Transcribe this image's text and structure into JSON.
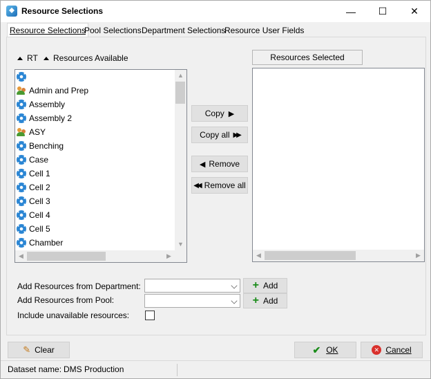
{
  "window": {
    "title": "Resource Selections",
    "minimize_glyph": "—",
    "maximize_glyph": "☐",
    "close_glyph": "✕"
  },
  "tabs": [
    {
      "label": "Resource Selections",
      "active": true
    },
    {
      "label": "Pool Selections",
      "active": false
    },
    {
      "label": "Department Selections",
      "active": false
    },
    {
      "label": "Resource User Fields",
      "active": false
    }
  ],
  "available": {
    "sort_rt_label": "RT",
    "header_label": "Resources Available",
    "items": [
      {
        "label": "",
        "icon": "gear-icon"
      },
      {
        "label": "Admin and Prep",
        "icon": "people-icon"
      },
      {
        "label": "Assembly",
        "icon": "gear-icon"
      },
      {
        "label": "Assembly 2",
        "icon": "gear-icon"
      },
      {
        "label": "ASY",
        "icon": "people-icon"
      },
      {
        "label": "Benching",
        "icon": "gear-icon"
      },
      {
        "label": "Case",
        "icon": "gear-icon"
      },
      {
        "label": "Cell 1",
        "icon": "gear-icon"
      },
      {
        "label": "Cell 2",
        "icon": "gear-icon"
      },
      {
        "label": "Cell 3",
        "icon": "gear-icon"
      },
      {
        "label": "Cell 4",
        "icon": "gear-icon"
      },
      {
        "label": "Cell 5",
        "icon": "gear-icon"
      },
      {
        "label": "Chamber",
        "icon": "gear-icon"
      }
    ]
  },
  "selected": {
    "header_label": "Resources Selected"
  },
  "transfer": {
    "copy_label": "Copy",
    "copy_all_label": "Copy all",
    "remove_label": "Remove",
    "remove_all_label": "Remove all"
  },
  "filters": {
    "department_label": "Add Resources from Department:",
    "department_value": "",
    "pool_label": "Add Resources from Pool:",
    "pool_value": "",
    "add_label": "Add",
    "unavailable_label": "Include unavailable resources:",
    "unavailable_checked": false
  },
  "footer": {
    "clear_label": "Clear",
    "ok_label": "OK",
    "cancel_label": "Cancel"
  },
  "status": {
    "dataset_label": "Dataset name:",
    "dataset_value": "DMS Production"
  },
  "colors": {
    "window_bg": "#f0f0f0",
    "button_bg": "#e1e1e1",
    "gear_blue": "#2b86d4",
    "ok_green": "#1a8c1a",
    "cancel_red": "#d9302c"
  }
}
